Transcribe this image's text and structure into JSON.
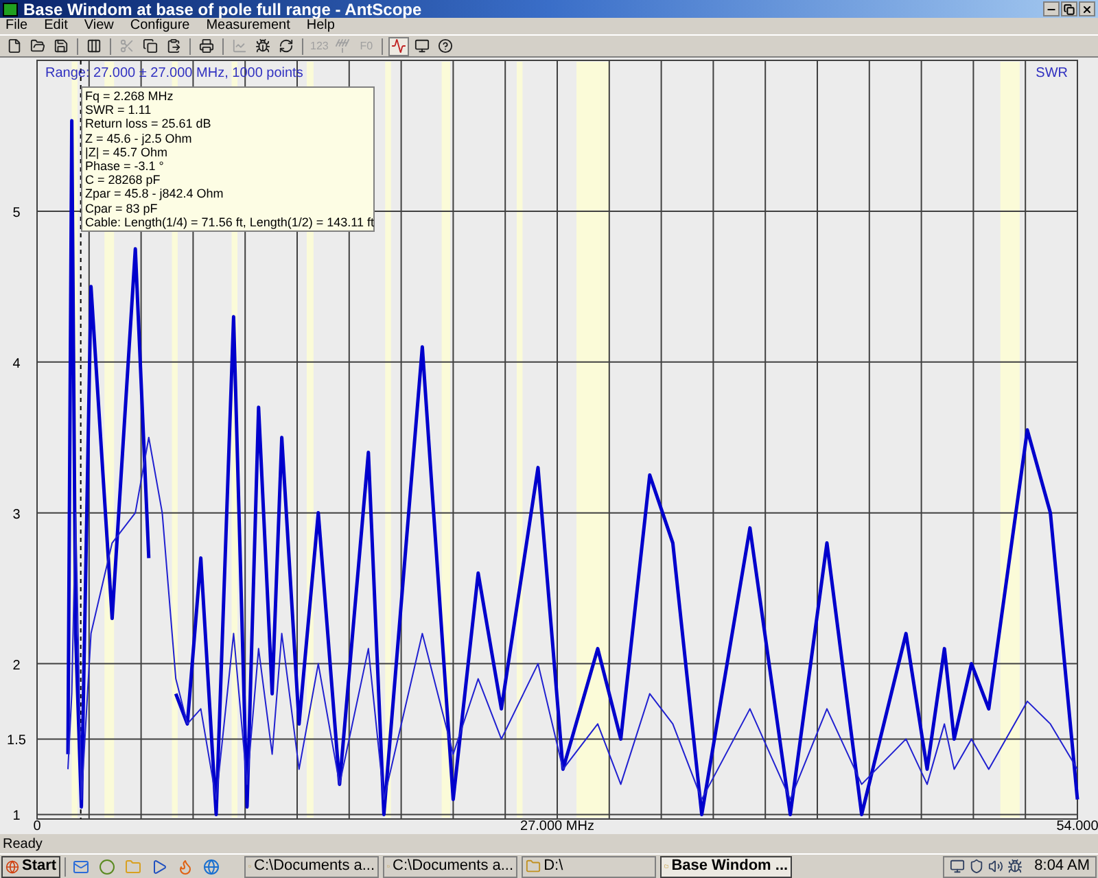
{
  "window": {
    "title": "Base Windom at base of pole full range - AntScope"
  },
  "menu": [
    "File",
    "Edit",
    "View",
    "Configure",
    "Measurement",
    "Help"
  ],
  "toolbar": [
    {
      "disabled": false,
      "selected": false
    },
    {
      "disabled": false,
      "selected": false
    },
    {
      "disabled": false,
      "selected": false
    },
    {
      "disabled": false,
      "selected": false
    },
    {
      "disabled": true,
      "selected": false
    },
    {
      "disabled": false,
      "selected": false
    },
    {
      "disabled": false,
      "selected": false
    },
    {
      "disabled": false,
      "selected": false
    },
    {
      "disabled": true,
      "selected": false
    },
    {
      "disabled": false,
      "selected": false
    },
    {
      "disabled": false,
      "selected": false
    },
    {
      "disabled": true,
      "selected": false,
      "label": "123"
    },
    {
      "disabled": true,
      "selected": false
    },
    {
      "disabled": true,
      "selected": false,
      "label": "F0"
    },
    {
      "disabled": false,
      "selected": true
    },
    {
      "disabled": false,
      "selected": false
    },
    {
      "disabled": false,
      "selected": false
    }
  ],
  "plot": {
    "range_label": "Range: 27.000 ± 27.000 MHz, 1000 points",
    "tooltip": [
      "Fq = 2.268 MHz",
      "SWR = 1.11",
      "Return loss = 25.61 dB",
      "Z = 45.6 - j2.5 Ohm",
      "|Z| = 45.7 Ohm",
      "Phase = -3.1 °",
      "C = 28268 pF",
      "Zpar = 45.8 - j842.4 Ohm",
      "Cpar = 83 pF",
      "Cable: Length(1/4) = 71.56 ft, Length(1/2) = 143.11 ft"
    ],
    "chart_data": {
      "type": "line",
      "ylabel": "SWR",
      "x": [
        1.6,
        1.8,
        2.0,
        2.3,
        2.8,
        3.9,
        5.1,
        5.8,
        6.5,
        7.2,
        7.8,
        8.5,
        9.3,
        10.2,
        10.9,
        11.5,
        12.2,
        12.7,
        13.6,
        14.6,
        15.7,
        17.2,
        18.0,
        20.0,
        21.6,
        22.9,
        24.1,
        26.0,
        27.3,
        29.1,
        30.3,
        31.8,
        33.0,
        34.5,
        37.0,
        39.1,
        41.0,
        42.8,
        45.1,
        46.2,
        47.1,
        47.6,
        48.5,
        49.4,
        51.4,
        52.6,
        54.0
      ],
      "series": [
        {
          "color": "#0000cc",
          "values": [
            1.4,
            5.6,
            2.2,
            1.05,
            4.5,
            2.3,
            4.75,
            2.7,
            null,
            1.8,
            1.6,
            2.7,
            1.0,
            4.3,
            1.05,
            3.7,
            1.8,
            3.5,
            1.6,
            3.0,
            1.2,
            3.4,
            1.0,
            4.1,
            1.1,
            2.6,
            1.7,
            3.3,
            1.3,
            2.1,
            1.5,
            3.25,
            2.8,
            1.0,
            2.9,
            1.0,
            2.8,
            1.0,
            2.2,
            1.3,
            2.1,
            1.5,
            2.0,
            1.7,
            3.55,
            3.0,
            1.1
          ]
        },
        {
          "color": "#2020d0",
          "values": [
            1.3,
            1.8,
            3.0,
            1.1,
            2.2,
            2.8,
            3.0,
            3.5,
            3.0,
            1.9,
            1.6,
            1.7,
            1.1,
            2.2,
            1.2,
            2.1,
            1.4,
            2.2,
            1.3,
            2.0,
            1.2,
            2.1,
            1.1,
            2.2,
            1.4,
            1.9,
            1.5,
            2.0,
            1.3,
            1.6,
            1.2,
            1.8,
            1.6,
            1.1,
            1.7,
            1.1,
            1.7,
            1.2,
            1.5,
            1.2,
            1.6,
            1.3,
            1.5,
            1.3,
            1.75,
            1.6,
            1.3
          ]
        }
      ],
      "xlim": [
        0,
        54
      ],
      "ylim": [
        0.97,
        6
      ],
      "grid": true,
      "bands": [
        {
          "axis": "x",
          "from": 1.8,
          "to": 2.1
        },
        {
          "axis": "x",
          "from": 3.5,
          "to": 4.0
        },
        {
          "axis": "x",
          "from": 7.0,
          "to": 7.3
        },
        {
          "axis": "x",
          "from": 10.1,
          "to": 10.4
        },
        {
          "axis": "x",
          "from": 14.0,
          "to": 14.35
        },
        {
          "axis": "x",
          "from": 18.07,
          "to": 18.37
        },
        {
          "axis": "x",
          "from": 21.0,
          "to": 21.45
        },
        {
          "axis": "x",
          "from": 24.9,
          "to": 25.2
        },
        {
          "axis": "x",
          "from": 28.0,
          "to": 29.7
        },
        {
          "axis": "x",
          "from": 50.0,
          "to": 51.0
        }
      ],
      "ref_lines": [
        {
          "axis": "x",
          "value": 2.268
        }
      ],
      "xticks": [
        {
          "value": 0,
          "label": "0"
        },
        {
          "value": 27,
          "label": "27.000 MHz"
        },
        {
          "value": 54,
          "label": "54.000"
        }
      ],
      "yticks": [
        {
          "value": 1,
          "label": "1"
        },
        {
          "value": 1.5,
          "label": "1.5"
        },
        {
          "value": 2,
          "label": "2"
        },
        {
          "value": 3,
          "label": "3"
        },
        {
          "value": 4,
          "label": "4"
        },
        {
          "value": 5,
          "label": "5"
        }
      ]
    }
  },
  "status_bar": "Ready",
  "taskbar": {
    "start": "Start",
    "tasks": [
      {
        "label": "C:\\Documents a...",
        "selected": false
      },
      {
        "label": "C:\\Documents a...",
        "selected": false
      },
      {
        "label": "D:\\",
        "selected": false
      },
      {
        "label": "Base Windom ...",
        "selected": true
      }
    ],
    "time": "8:04 AM"
  }
}
